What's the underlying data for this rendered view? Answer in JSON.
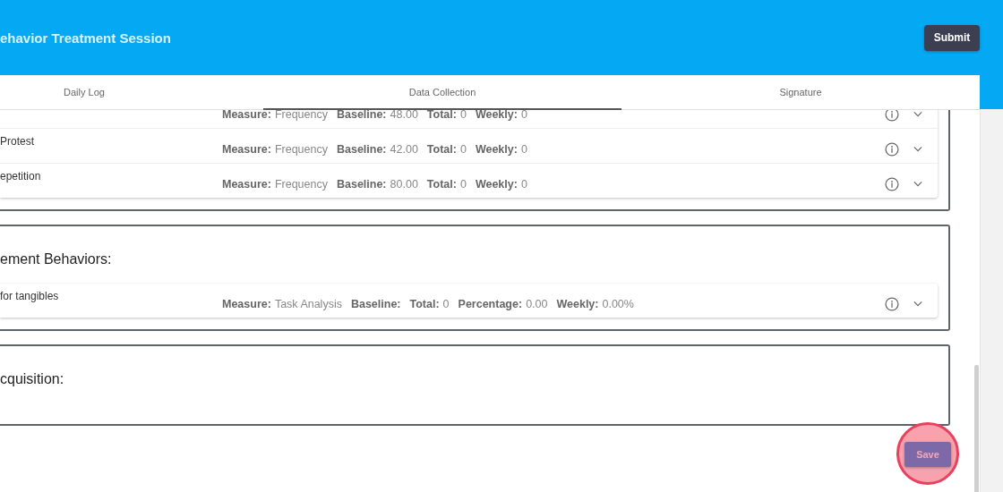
{
  "header": {
    "title": "ehavior Treatment Session",
    "submit_button": "Submit"
  },
  "tabs": [
    {
      "label": "Daily Log",
      "selected": false
    },
    {
      "label": "Data Collection",
      "selected": true
    },
    {
      "label": "Signature",
      "selected": false
    }
  ],
  "sections": [
    {
      "rows": [
        {
          "stats": [
            {
              "label": "Measure:",
              "value": "Frequency"
            },
            {
              "label": "Baseline:",
              "value": "48.00"
            },
            {
              "label": "Total:",
              "value": "0"
            },
            {
              "label": "Weekly:",
              "value": "0"
            }
          ]
        },
        {
          "name": "Protest",
          "stats": [
            {
              "label": "Measure:",
              "value": "Frequency"
            },
            {
              "label": "Baseline:",
              "value": "42.00"
            },
            {
              "label": "Total:",
              "value": "0"
            },
            {
              "label": "Weekly:",
              "value": "0"
            }
          ]
        },
        {
          "name": "epetition",
          "stats": [
            {
              "label": "Measure:",
              "value": "Frequency"
            },
            {
              "label": "Baseline:",
              "value": "80.00"
            },
            {
              "label": "Total:",
              "value": "0"
            },
            {
              "label": "Weekly:",
              "value": "0"
            }
          ]
        }
      ]
    },
    {
      "title": "ement Behaviors:",
      "rows": [
        {
          "name": "for tangibles",
          "stats": [
            {
              "label": "Measure:",
              "value": "Task Analysis"
            },
            {
              "label": "Baseline:"
            },
            {
              "label": "Total:",
              "value": "0"
            },
            {
              "label": "Percentage:",
              "value": "0.00"
            },
            {
              "label": "Weekly:",
              "value": "0.00%"
            }
          ]
        }
      ]
    },
    {
      "title": "cquisition:"
    }
  ],
  "save_button": "Save"
}
